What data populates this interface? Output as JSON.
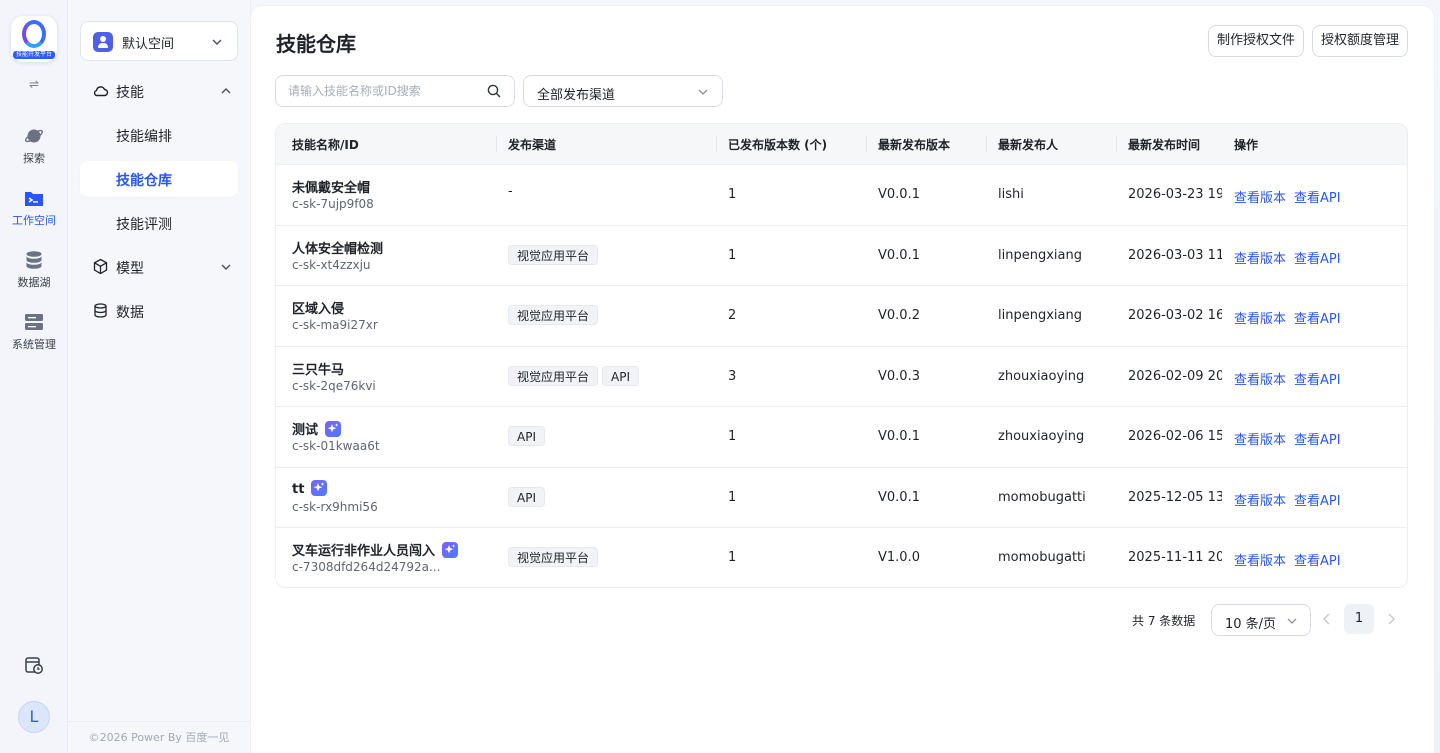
{
  "rail": {
    "logo_text": "技能开发平台",
    "items": [
      {
        "label": "探索",
        "icon": "planet-icon"
      },
      {
        "label": "工作空间",
        "icon": "terminal-folder-icon"
      },
      {
        "label": "数据湖",
        "icon": "database-icon"
      },
      {
        "label": "系统管理",
        "icon": "server-icon"
      }
    ],
    "avatar_letter": "L"
  },
  "sidebar": {
    "space_label": "默认空间",
    "skill_label": "技能",
    "skill_children": [
      "技能编排",
      "技能仓库",
      "技能评测"
    ],
    "model_label": "模型",
    "data_label": "数据",
    "footer": "©2026 Power By 百度一见"
  },
  "header": {
    "title": "技能仓库",
    "btn_make_license": "制作授权文件",
    "btn_quota": "授权额度管理"
  },
  "filters": {
    "search_placeholder": "请输入技能名称或ID搜索",
    "channel_value": "全部发布渠道"
  },
  "table": {
    "columns": [
      "技能名称/ID",
      "发布渠道",
      "已发布版本数 (个)",
      "最新发布版本",
      "最新发布人",
      "最新发布时间",
      "操作"
    ],
    "action_view_version": "查看版本",
    "action_view_api": "查看API",
    "rows": [
      {
        "name": "未佩戴安全帽",
        "id": "c-sk-7ujp9f08",
        "ai": false,
        "channels": [
          "-"
        ],
        "count": "1",
        "version": "V0.0.1",
        "publisher": "lishi",
        "time": "2026-03-23 19:"
      },
      {
        "name": "人体安全帽检测",
        "id": "c-sk-xt4zzxju",
        "ai": false,
        "channels": [
          "视觉应用平台"
        ],
        "count": "1",
        "version": "V0.0.1",
        "publisher": "linpengxiang",
        "time": "2026-03-03 11:"
      },
      {
        "name": "区域入侵",
        "id": "c-sk-ma9i27xr",
        "ai": false,
        "channels": [
          "视觉应用平台"
        ],
        "count": "2",
        "version": "V0.0.2",
        "publisher": "linpengxiang",
        "time": "2026-03-02 16:"
      },
      {
        "name": "三只牛马",
        "id": "c-sk-2qe76kvi",
        "ai": false,
        "channels": [
          "视觉应用平台",
          "API"
        ],
        "count": "3",
        "version": "V0.0.3",
        "publisher": "zhouxiaoying",
        "time": "2026-02-09 20:"
      },
      {
        "name": "测试",
        "id": "c-sk-01kwaa6t",
        "ai": true,
        "channels": [
          "API"
        ],
        "count": "1",
        "version": "V0.0.1",
        "publisher": "zhouxiaoying",
        "time": "2026-02-06 15:"
      },
      {
        "name": "tt",
        "id": "c-sk-rx9hmi56",
        "ai": true,
        "channels": [
          "API"
        ],
        "count": "1",
        "version": "V0.0.1",
        "publisher": "momobugatti",
        "time": "2025-12-05 13:"
      },
      {
        "name": "叉车运行非作业人员闯入",
        "id": "c-7308dfd264d24792a...",
        "ai": true,
        "channels": [
          "视觉应用平台"
        ],
        "count": "1",
        "version": "V1.0.0",
        "publisher": "momobugatti",
        "time": "2025-11-11 20:"
      }
    ]
  },
  "pagination": {
    "total_text": "共 7 条数据",
    "page_size": "10 条/页",
    "current_page": "1"
  },
  "colors": {
    "accent": "#2a56f5",
    "header_bg": "#f6f7f9",
    "tag_bg": "#f1f3f6"
  }
}
